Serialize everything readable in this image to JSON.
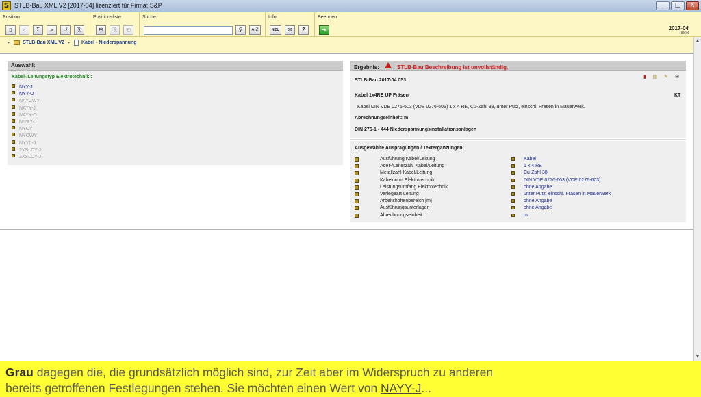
{
  "window": {
    "app_icon_letter": "S",
    "title": "STLB-Bau XML V2 [2017-04] lizenziert für Firma: S&P",
    "buttons": [
      "_",
      "□",
      "X"
    ]
  },
  "toolbar": {
    "groups": {
      "position": "Position",
      "positionsliste": "Positionsliste",
      "suche": "Suche",
      "info": "Info",
      "beenden": "Beenden"
    },
    "search_button_label": "A-Z",
    "info_new_label": "NEU",
    "info_help_label": "?",
    "version": "2017-04",
    "version_sub": "0008"
  },
  "breadcrumb": {
    "items": [
      "STLB-Bau XML V2",
      "Kabel - Niederspannung"
    ]
  },
  "auswahl": {
    "header": "Auswahl:",
    "subheader": "Kabel-/Leitungstyp Elektrotechnik :",
    "options": [
      {
        "label": "NYY-J",
        "state": "active"
      },
      {
        "label": "NYY-O",
        "state": "active"
      },
      {
        "label": "NAYCWY",
        "state": "inactive"
      },
      {
        "label": "NAYY-J",
        "state": "inactive"
      },
      {
        "label": "NAYY-O",
        "state": "inactive"
      },
      {
        "label": "NI2XY-J",
        "state": "inactive"
      },
      {
        "label": "NYCY",
        "state": "inactive"
      },
      {
        "label": "NYCWY",
        "state": "inactive"
      },
      {
        "label": "NYY0-J",
        "state": "inactive"
      },
      {
        "label": "2YSLCY-J",
        "state": "inactive"
      },
      {
        "label": "2XSLCY-J",
        "state": "inactive"
      }
    ]
  },
  "ergebnis": {
    "label": "Ergebnis:",
    "error": "STLB-Bau Beschreibung ist unvollständig.",
    "ref": "STLB-Bau 2017-04 053",
    "title": "Kabel 1x4RE UP Fräsen",
    "unit_code": "KT",
    "description": "Kabel DIN VDE 0276-603 (VDE 0276-603) 1 x 4 RE, Cu-Zahl 38, unter Putz, einschl. Fräsen in Mauerwerk.",
    "abrechnung": "Abrechnungseinheit: m",
    "din": "DIN 276-1 - 444 Niederspannungsinstallationsanlagen"
  },
  "selections": {
    "header": "Ausgewählte Ausprägungen / Textergänzungen:",
    "rows": [
      {
        "name": "Ausführung Kabel/Leitung",
        "value": "Kabel"
      },
      {
        "name": "Ader-/Leiterzahl Kabel/Leitung",
        "value": "1 x 4 RE"
      },
      {
        "name": "Metallzahl Kabel/Leitung",
        "value": "Cu-Zahl 38"
      },
      {
        "name": "Kabelnorm Elektrotechnik",
        "value": "DIN VDE 0276-603 (VDE 0276-603)"
      },
      {
        "name": "Leistungsumfang Elektrotechnik",
        "value": "ohne Angabe"
      },
      {
        "name": "Verlegeart Leitung",
        "value": "unter Putz, einschl. Fräsen in Mauerwerk"
      },
      {
        "name": "Arbeitshöhenbereich [m]",
        "value": "ohne Angabe"
      },
      {
        "name": "Ausführungsunterlagen",
        "value": "ohne Angabe"
      },
      {
        "name": "Abrechnungseinheit",
        "value": "m"
      }
    ]
  },
  "caption": {
    "bold": "Grau",
    "line1_rest": " dagegen die, die grundsätzlich möglich sind, zur Zeit aber im Widerspruch zu anderen",
    "line2_pre": "bereits getroffenen Festlegungen stehen. Sie möchten einen Wert von ",
    "line2_link": "NAYY-J",
    "line2_post": "..."
  },
  "colors": {
    "toolbar_bg": "#fdf6c5",
    "active_option": "#1f2f9a",
    "inactive_option": "#9a9a9a",
    "error_red": "#d21f1f",
    "subheader_green": "#238a22",
    "caption_bg": "#ffff33"
  }
}
